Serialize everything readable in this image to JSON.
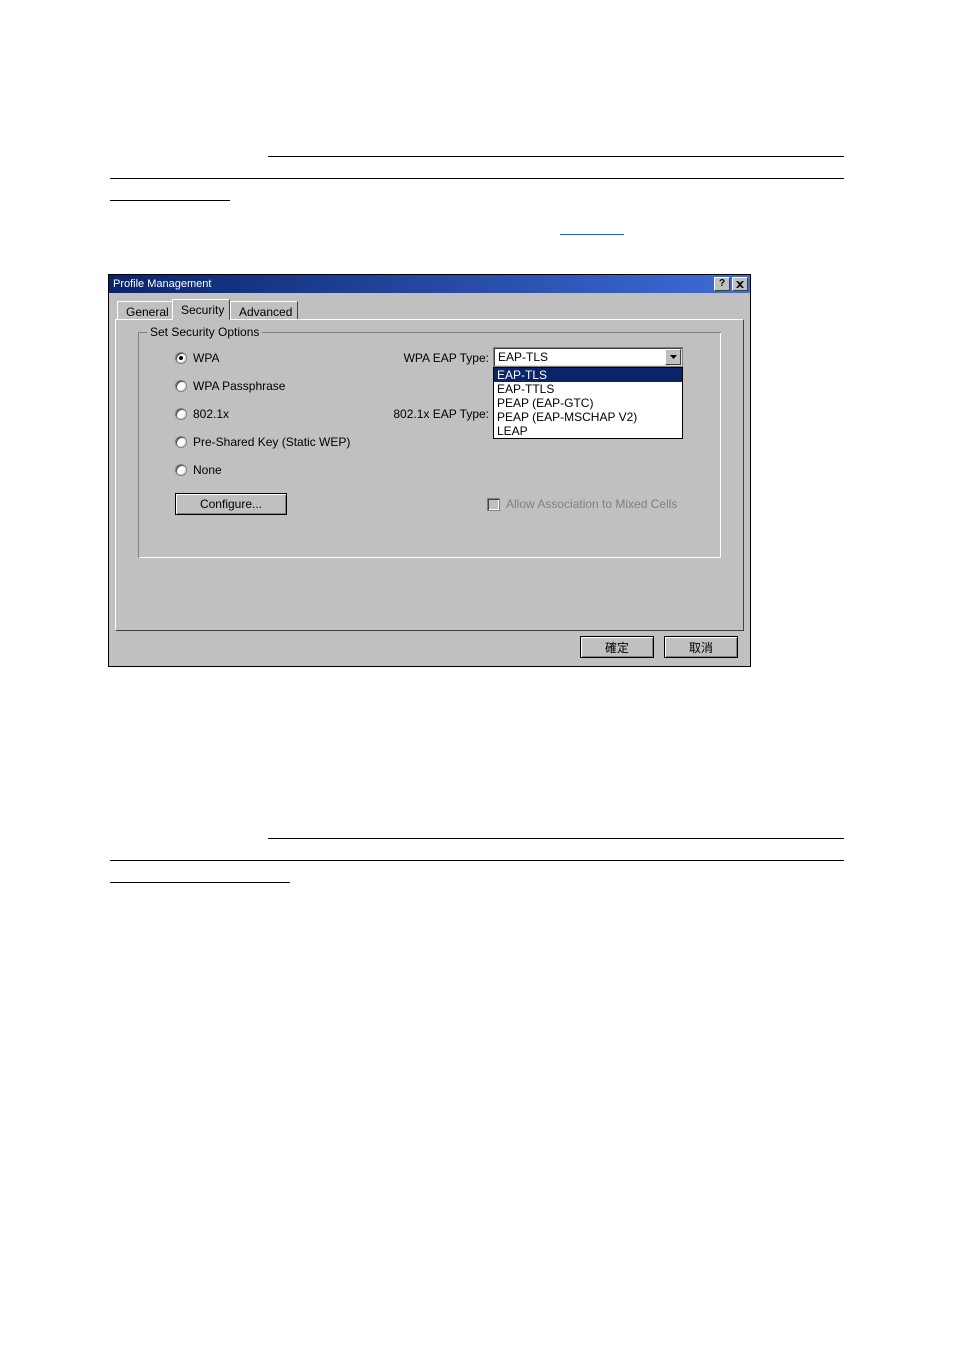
{
  "titlebar": {
    "title": "Profile Management"
  },
  "tabs": {
    "general": "General",
    "security": "Security",
    "advanced": "Advanced"
  },
  "group": {
    "title": "Set Security Options"
  },
  "radios": {
    "wpa": "WPA",
    "wpa_pass": "WPA Passphrase",
    "dot1x": "802.1x",
    "psk": "Pre-Shared Key (Static WEP)",
    "none": "None"
  },
  "labels": {
    "wpa_eap_type": "WPA EAP Type:",
    "dot1x_eap_type": "802.1x EAP Type:"
  },
  "combo": {
    "wpa_value": "EAP-TLS",
    "options": [
      "EAP-TLS",
      "EAP-TTLS",
      "PEAP (EAP-GTC)",
      "PEAP (EAP-MSCHAP V2)",
      "LEAP"
    ]
  },
  "buttons": {
    "configure": "Configure...",
    "ok": "確定",
    "cancel": "取消"
  },
  "checkbox": {
    "mixed": "Allow Association to Mixed Cells"
  }
}
